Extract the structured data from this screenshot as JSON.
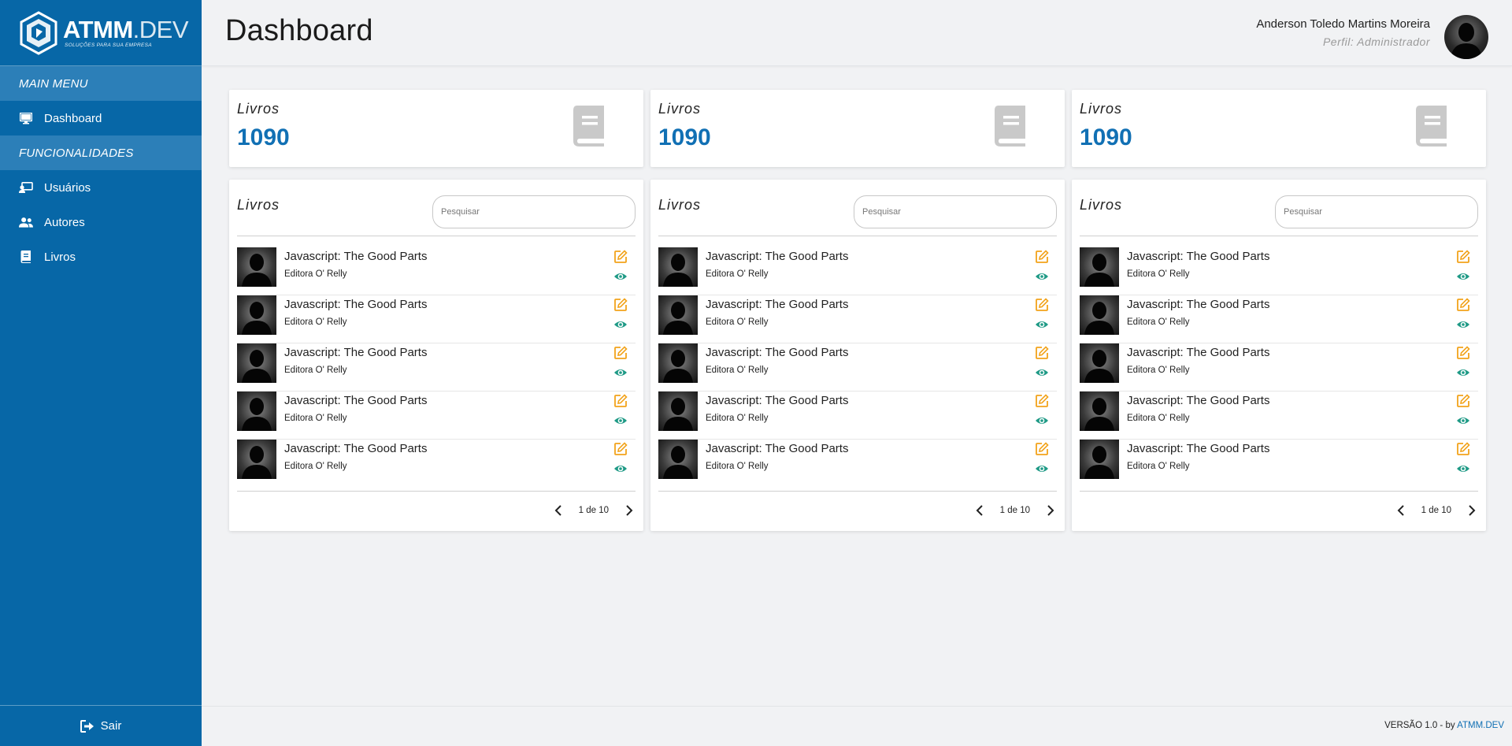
{
  "brand": {
    "name_bold": "ATMM",
    "name_light": ".DEV",
    "tagline": "SOLUÇÕES PARA SUA EMPRESA",
    "primary_color": "#0767a7"
  },
  "sidebar": {
    "sections": [
      {
        "header": "MAIN MENU",
        "items": [
          {
            "label": "Dashboard",
            "icon": "monitor-icon"
          }
        ]
      },
      {
        "header": "FUNCIONALIDADES",
        "items": [
          {
            "label": "Usuários",
            "icon": "users-admin-icon"
          },
          {
            "label": "Autores",
            "icon": "user-group-icon"
          },
          {
            "label": "Livros",
            "icon": "book-icon"
          }
        ]
      }
    ],
    "logout_label": "Sair"
  },
  "header": {
    "title": "Dashboard",
    "user_name": "Anderson Toledo Martins Moreira",
    "user_role": "Perfil: Administrador"
  },
  "stats": [
    {
      "label": "Livros",
      "value": "1090",
      "icon": "book-icon"
    },
    {
      "label": "Livros",
      "value": "1090",
      "icon": "book-icon"
    },
    {
      "label": "Livros",
      "value": "1090",
      "icon": "book-icon"
    }
  ],
  "lists": [
    {
      "title": "Livros",
      "search_placeholder": "Pesquisar",
      "items": [
        {
          "title": "Javascript: The Good Parts",
          "subtitle": "Editora O' Relly"
        },
        {
          "title": "Javascript: The Good Parts",
          "subtitle": "Editora O' Relly"
        },
        {
          "title": "Javascript: The Good Parts",
          "subtitle": "Editora O' Relly"
        },
        {
          "title": "Javascript: The Good Parts",
          "subtitle": "Editora O' Relly"
        },
        {
          "title": "Javascript: The Good Parts",
          "subtitle": "Editora O' Relly"
        }
      ],
      "pagination": "1 de 10"
    },
    {
      "title": "Livros",
      "search_placeholder": "Pesquisar",
      "items": [
        {
          "title": "Javascript: The Good Parts",
          "subtitle": "Editora O' Relly"
        },
        {
          "title": "Javascript: The Good Parts",
          "subtitle": "Editora O' Relly"
        },
        {
          "title": "Javascript: The Good Parts",
          "subtitle": "Editora O' Relly"
        },
        {
          "title": "Javascript: The Good Parts",
          "subtitle": "Editora O' Relly"
        },
        {
          "title": "Javascript: The Good Parts",
          "subtitle": "Editora O' Relly"
        }
      ],
      "pagination": "1 de 10"
    },
    {
      "title": "Livros",
      "search_placeholder": "Pesquisar",
      "items": [
        {
          "title": "Javascript: The Good Parts",
          "subtitle": "Editora O' Relly"
        },
        {
          "title": "Javascript: The Good Parts",
          "subtitle": "Editora O' Relly"
        },
        {
          "title": "Javascript: The Good Parts",
          "subtitle": "Editora O' Relly"
        },
        {
          "title": "Javascript: The Good Parts",
          "subtitle": "Editora O' Relly"
        },
        {
          "title": "Javascript: The Good Parts",
          "subtitle": "Editora O' Relly"
        }
      ],
      "pagination": "1 de 10"
    }
  ],
  "footer": {
    "text": "VERSÃO 1.0 - by ",
    "link": "ATMM.DEV"
  },
  "colors": {
    "accent_blue": "#1170b4",
    "edit_orange": "#f2a31b",
    "view_teal": "#1f9a86"
  }
}
